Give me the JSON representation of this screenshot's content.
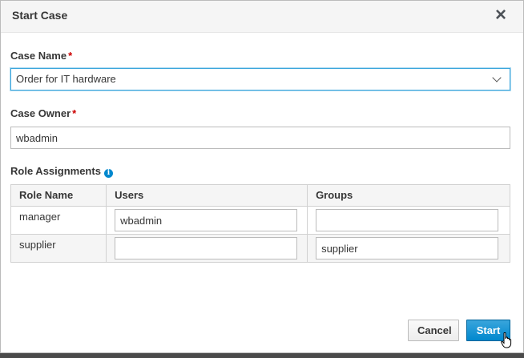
{
  "modal": {
    "title": "Start Case",
    "close_glyph": "×"
  },
  "case_name": {
    "label": "Case Name",
    "required_mark": "*",
    "selected": "Order for IT hardware"
  },
  "case_owner": {
    "label": "Case Owner",
    "required_mark": "*",
    "value": "wbadmin"
  },
  "role_assignments": {
    "label": "Role Assignments",
    "info_glyph": "i",
    "columns": [
      "Role Name",
      "Users",
      "Groups"
    ],
    "rows": [
      {
        "role": "manager",
        "users": "wbadmin",
        "groups": ""
      },
      {
        "role": "supplier",
        "users": "",
        "groups": "supplier"
      }
    ]
  },
  "footer": {
    "cancel_label": "Cancel",
    "start_label": "Start"
  },
  "colors": {
    "primary": "#0088ce",
    "focus_border": "#39a5dc",
    "required": "#cc0000"
  }
}
